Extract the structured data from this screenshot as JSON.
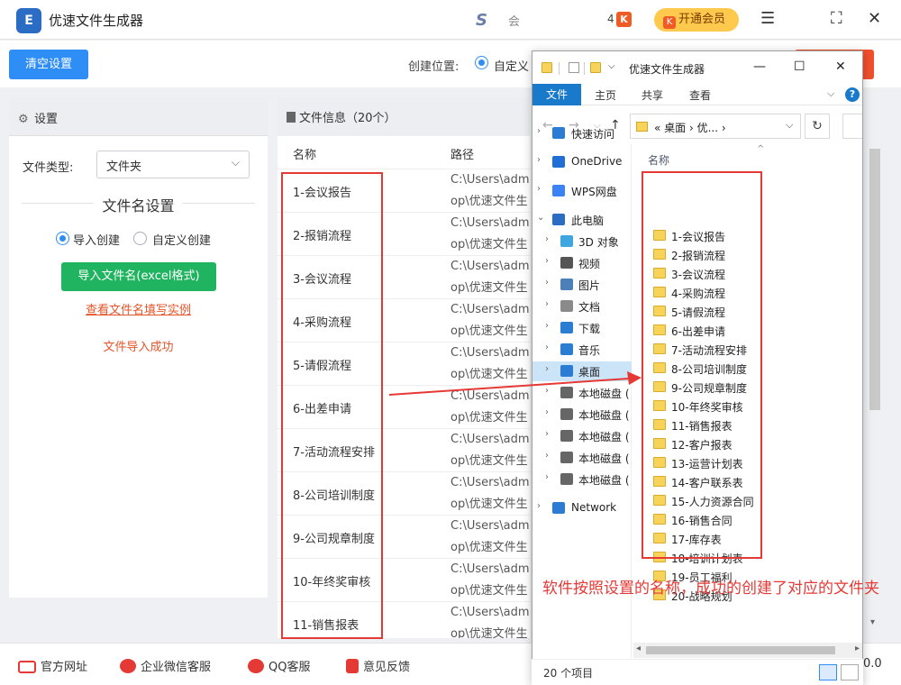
{
  "app": {
    "title": "优速文件生成器",
    "logo_glyph": "E",
    "brand_glyph": "S",
    "brand_text": "会",
    "notif_count": "4",
    "notif_glyph": "K",
    "vip_label": "开通会员",
    "vip_glyph": "K",
    "menu_glyph": "☰",
    "max_glyph": "⛶",
    "close_glyph": "✕"
  },
  "toolbar": {
    "clear_label": "清空设置",
    "location_label": "创建位置:",
    "location_option": "自定义"
  },
  "settings": {
    "header": "设置",
    "gear_glyph": "⚙",
    "file_type_label": "文件类型:",
    "file_type_value": "文件夹",
    "chev_glyph": "⌵",
    "name_section_title": "文件名设置",
    "radio_import": "导入创建",
    "radio_custom": "自定义创建",
    "import_button": "导入文件名(excel格式)",
    "example_link": "查看文件名填写实例",
    "import_status": "文件导入成功"
  },
  "fileinfo": {
    "header": "文件信息（20个）",
    "col_name": "名称",
    "col_path": "路径",
    "rows": [
      {
        "name": "1-会议报告",
        "path1": "C:\\Users\\admi",
        "path2": "op\\优速文件生"
      },
      {
        "name": "2-报销流程",
        "path1": "C:\\Users\\admi",
        "path2": "op\\优速文件生"
      },
      {
        "name": "3-会议流程",
        "path1": "C:\\Users\\admi",
        "path2": "op\\优速文件生"
      },
      {
        "name": "4-采购流程",
        "path1": "C:\\Users\\admi",
        "path2": "op\\优速文件生"
      },
      {
        "name": "5-请假流程",
        "path1": "C:\\Users\\admi",
        "path2": "op\\优速文件生"
      },
      {
        "name": "6-出差申请",
        "path1": "C:\\Users\\admi",
        "path2": "op\\优速文件生"
      },
      {
        "name": "7-活动流程安排",
        "path1": "C:\\Users\\admi",
        "path2": "op\\优速文件生"
      },
      {
        "name": "8-公司培训制度",
        "path1": "C:\\Users\\admi",
        "path2": "op\\优速文件生"
      },
      {
        "name": "9-公司规章制度",
        "path1": "C:\\Users\\admi",
        "path2": "op\\优速文件生"
      },
      {
        "name": "10-年终奖审核",
        "path1": "C:\\Users\\admi",
        "path2": "op\\优速文件生"
      },
      {
        "name": "11-销售报表",
        "path1": "C:\\Users\\admi",
        "path2": "op\\优速文件生"
      }
    ]
  },
  "footer": {
    "website": "官方网址",
    "wechat": "企业微信客服",
    "qq": "QQ客服",
    "feedback": "意见反馈",
    "version": "0.0"
  },
  "explorer": {
    "title": "优速文件生成器",
    "tabs": {
      "file": "文件",
      "home": "主页",
      "share": "共享",
      "view": "查看"
    },
    "help_glyph": "?",
    "ribbon_chev": "⌵",
    "address": "« 桌面 › 优... ›",
    "address_dropdown": "⌵",
    "refresh_glyph": "↻",
    "back_glyph": "←",
    "forward_glyph": "→",
    "recent_glyph": "⌵",
    "up_glyph": "↑",
    "min_glyph": "—",
    "max_glyph": "☐",
    "close_glyph": "✕",
    "qa_dropdown": "⌵",
    "expand_glyph": "›",
    "expanded_glyph": "⌄",
    "sort_glyph": "^",
    "nav": [
      {
        "label": "快速访问",
        "color": "#2b7cd3"
      },
      {
        "label": "OneDrive",
        "color": "#1f6fd6"
      },
      {
        "label": "WPS网盘",
        "color": "#3b82f6"
      },
      {
        "label": "此电脑",
        "color": "#2b6cc4"
      },
      {
        "label": "3D 对象",
        "color": "#3fa7e0"
      },
      {
        "label": "视频",
        "color": "#555555"
      },
      {
        "label": "图片",
        "color": "#4d7fb8"
      },
      {
        "label": "文档",
        "color": "#8a8a8a"
      },
      {
        "label": "下载",
        "color": "#2b7cd3"
      },
      {
        "label": "音乐",
        "color": "#2b7cd3"
      },
      {
        "label": "桌面",
        "color": "#2b7cd3"
      },
      {
        "label": "本地磁盘 (",
        "color": "#666666"
      },
      {
        "label": "本地磁盘 (",
        "color": "#666666"
      },
      {
        "label": "本地磁盘 (",
        "color": "#666666"
      },
      {
        "label": "本地磁盘 (",
        "color": "#666666"
      },
      {
        "label": "本地磁盘 (",
        "color": "#666666"
      },
      {
        "label": "Network",
        "color": "#2b7cd3"
      }
    ],
    "column_name": "名称",
    "folders": [
      "1-会议报告",
      "2-报销流程",
      "3-会议流程",
      "4-采购流程",
      "5-请假流程",
      "6-出差申请",
      "7-活动流程安排",
      "8-公司培训制度",
      "9-公司规章制度",
      "10-年终奖审核",
      "11-销售报表",
      "12-客户报表",
      "13-运营计划表",
      "14-客户联系表",
      "15-人力资源合同",
      "16-销售合同",
      "17-库存表",
      "18-培训计划表",
      "19-员工福利",
      "20-战略规划"
    ],
    "status_count": "20 个项目",
    "scroll_left": "◂",
    "scroll_right": "▸"
  },
  "main_scroll_down": "▾",
  "annotation": "软件按照设置的名称，成功的创建了对应的文件夹",
  "colors": {
    "accent": "#2e8ef5",
    "green": "#20b461",
    "red": "#e53935",
    "folder": "#f7d35a"
  }
}
